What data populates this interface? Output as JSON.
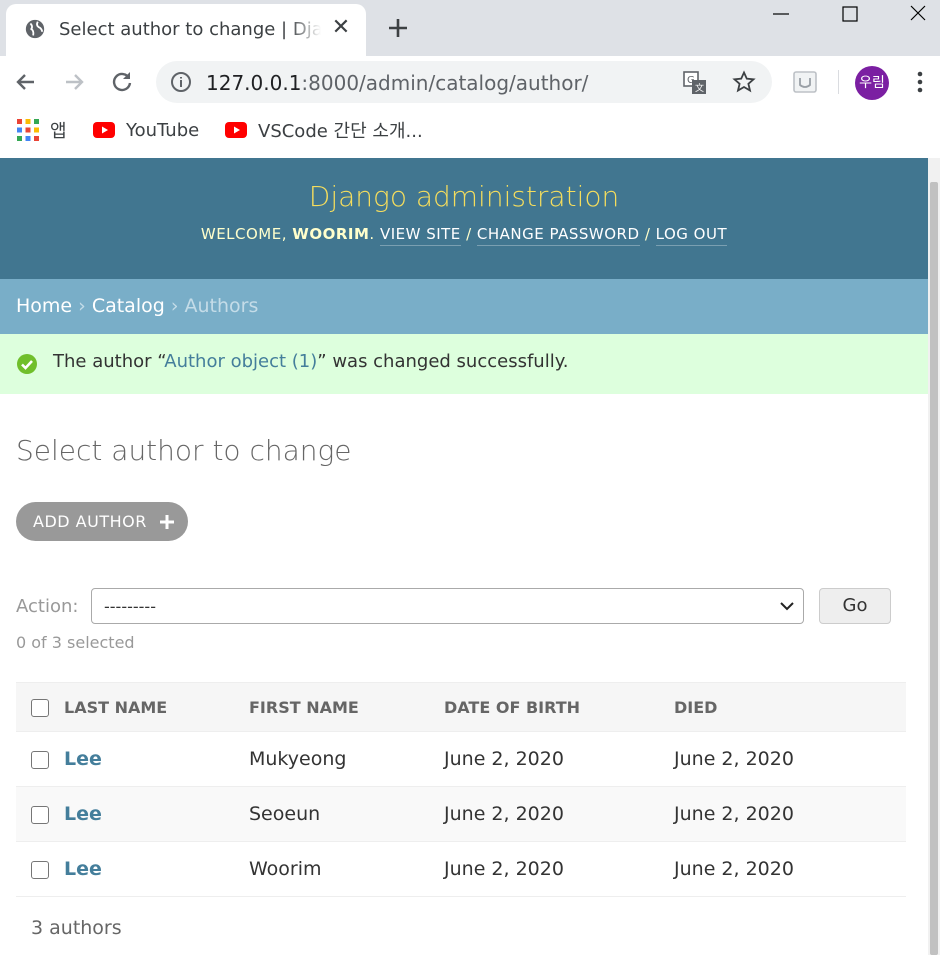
{
  "browser": {
    "tab_title": "Select author to change | Django site admin",
    "url_host": "127.0.0.1",
    "url_rest": ":8000/admin/catalog/author/",
    "profile_label": "우림",
    "bookmarks": [
      {
        "label": "앱",
        "icon": "apps-grid-icon"
      },
      {
        "label": "YouTube",
        "icon": "youtube-icon"
      },
      {
        "label": "VSCode 간단 소개...",
        "icon": "youtube-icon"
      }
    ]
  },
  "header": {
    "site_name": "Django administration",
    "welcome": "WELCOME,",
    "username": "WOORIM",
    "view_site": "VIEW SITE",
    "change_password": "CHANGE PASSWORD",
    "log_out": "LOG OUT",
    "separator": "/"
  },
  "breadcrumbs": {
    "home": "Home",
    "catalog": "Catalog",
    "current": "Authors",
    "separator": "›"
  },
  "message": {
    "prefix": "The author “",
    "link": "Author object (1)",
    "suffix": "” was changed successfully."
  },
  "page": {
    "title": "Select author to change",
    "add_button": "ADD AUTHOR"
  },
  "actions": {
    "label": "Action:",
    "selected_option": "---------",
    "go_label": "Go",
    "selected_count": "0 of 3 selected"
  },
  "table": {
    "headers": [
      "LAST NAME",
      "FIRST NAME",
      "DATE OF BIRTH",
      "DIED"
    ],
    "rows": [
      {
        "last_name": "Lee",
        "first_name": "Mukyeong",
        "date_of_birth": "June 2, 2020",
        "died": "June 2, 2020"
      },
      {
        "last_name": "Lee",
        "first_name": "Seoeun",
        "date_of_birth": "June 2, 2020",
        "died": "June 2, 2020"
      },
      {
        "last_name": "Lee",
        "first_name": "Woorim",
        "date_of_birth": "June 2, 2020",
        "died": "June 2, 2020"
      }
    ]
  },
  "paginator": "3 authors",
  "colors": {
    "header_bg": "#417690",
    "site_name": "#f5dd5d",
    "breadcrumbs_bg": "#79aec8",
    "message_bg": "#ddffdd",
    "link": "#447e9b",
    "profile_bg": "#7b1fa2"
  }
}
